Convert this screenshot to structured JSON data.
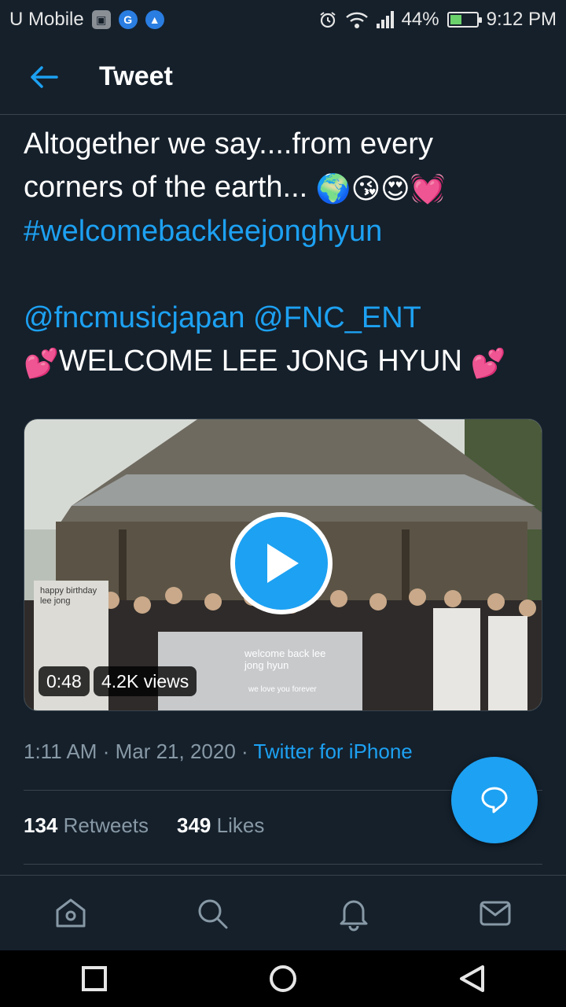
{
  "status_bar": {
    "carrier": "U Mobile",
    "battery": "44%",
    "battery_level": 0.44,
    "time": "9:12 PM",
    "icons": [
      "image-icon",
      "google-icon",
      "drive-icon",
      "alarm-icon",
      "wifi-icon",
      "signal-icon",
      "battery-icon"
    ]
  },
  "header": {
    "title": "Tweet",
    "back_icon": "back-arrow-icon"
  },
  "tweet": {
    "line1": "Altogether we say....from every",
    "line2": "corners of the earth...",
    "line2_emojis": "🌍😘😍💓",
    "hashtag": "#welcomebackleejonghyun",
    "mention1": "@fncmusicjapan",
    "mention2": "@FNC_ENT",
    "heart_emoji": "💕",
    "welcome_text": "WELCOME LEE JONG HYUN"
  },
  "media": {
    "duration": "0:48",
    "views": "4.2K views",
    "banner_left": "happy birthday lee jong",
    "banner_right": "welcome back lee jong hyun",
    "banner_right_sub": "we love you forever"
  },
  "meta": {
    "time": "1:11 AM",
    "date": "Mar 21, 2020",
    "source": "Twitter for iPhone"
  },
  "stats": {
    "retweets_count": "134",
    "retweets_label": "Retweets",
    "likes_count": "349",
    "likes_label": "Likes"
  },
  "tabs": [
    "home-icon",
    "search-icon",
    "notifications-icon",
    "messages-icon"
  ],
  "colors": {
    "background": "#15202b",
    "accent": "#1da1f2",
    "muted": "#8899a6",
    "border": "#38444d"
  }
}
